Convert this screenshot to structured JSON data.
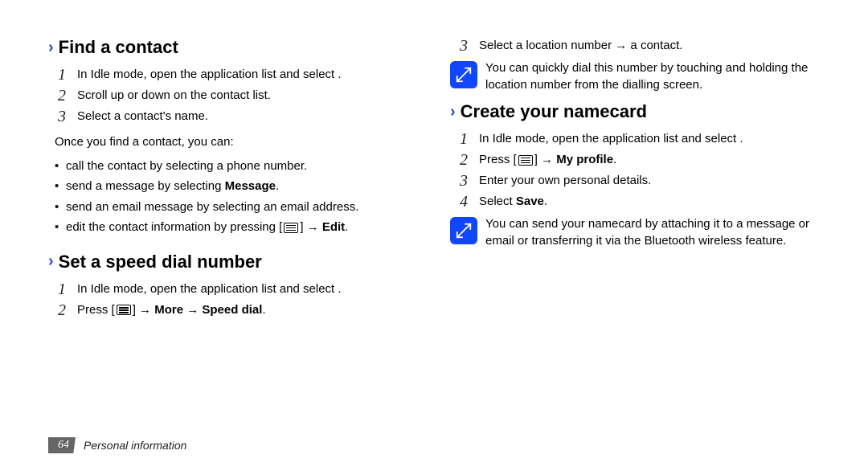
{
  "left": {
    "find": {
      "heading": "Find a contact",
      "steps": [
        "In Idle mode, open the application list and select       .",
        "Scroll up or down on the contact list.",
        "Select a contact's name."
      ],
      "once_intro": "Once you find a contact, you can:",
      "bullets": {
        "b0": "call the contact by selecting a phone number.",
        "b1_pre": "send a message by selecting ",
        "b1_bold": "Message",
        "b1_post": ".",
        "b2": "send an email message by selecting an email address.",
        "b3_pre": "edit the contact information by pressing [",
        "b3_post": "] → ",
        "b3_bold": "Edit",
        "b3_end": "."
      }
    },
    "speed": {
      "heading": "Set a speed dial number",
      "s1": "In Idle mode, open the application list and select       .",
      "s2_pre": "Press [",
      "s2_mid": "] → ",
      "s2_bold1": "More",
      "s2_arrow": " → ",
      "s2_bold2": "Speed dial",
      "s2_end": "."
    }
  },
  "right": {
    "s3": "Select a location number → a contact.",
    "note1": "You can quickly dial this number by touching and holding the location number from the dialling screen.",
    "create": {
      "heading": "Create your namecard",
      "s1": "In Idle mode, open the application list and select       .",
      "s2_pre": "Press [",
      "s2_mid": "] → ",
      "s2_bold": "My profile",
      "s2_end": ".",
      "s3": "Enter your own personal details.",
      "s4_pre": "Select ",
      "s4_bold": "Save",
      "s4_end": "."
    },
    "note2": "You can send your namecard by attaching it to a message or email or transferring it via the Bluetooth wireless feature."
  },
  "footer": {
    "page": "64",
    "section": "Personal information"
  }
}
